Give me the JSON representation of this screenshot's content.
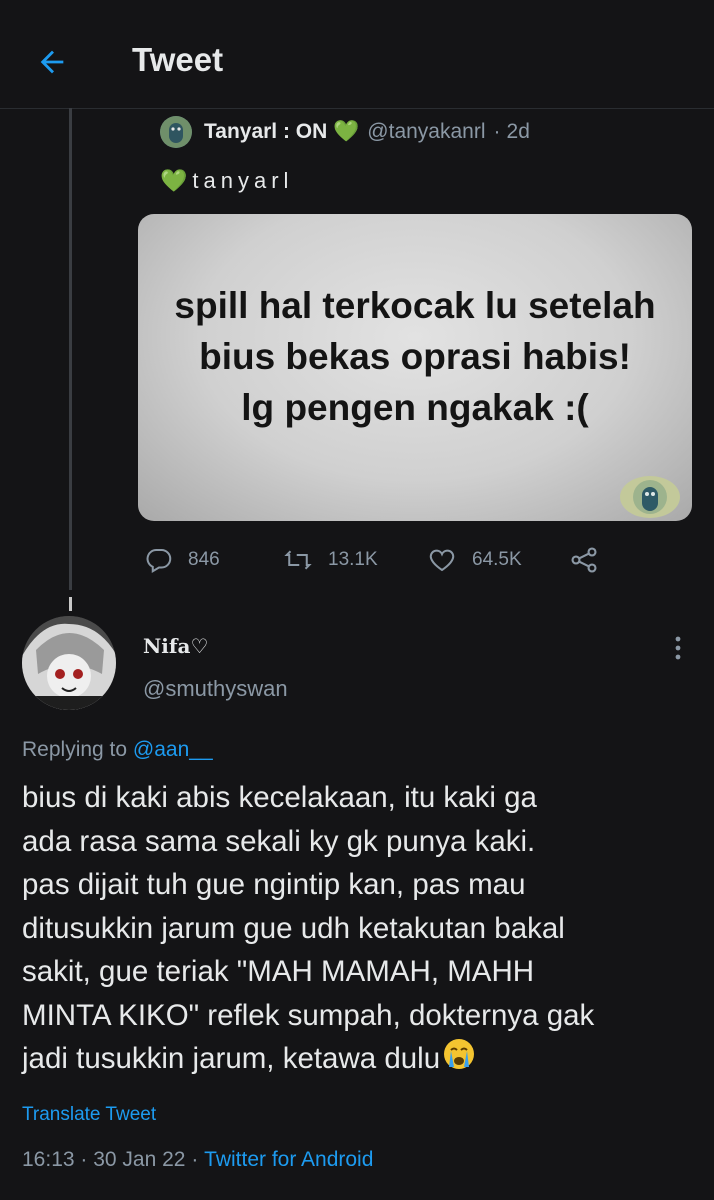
{
  "header": {
    "title": "Tweet"
  },
  "quoted_tweet": {
    "display_name": "Tanyarl : ON 💚",
    "handle": "@tanyakanrl",
    "separator": "·",
    "time": "2d",
    "body": "💚tanyarl",
    "image_text": "spill hal terkocak lu setelah\nbius bekas oprasi habis!\nlg pengen ngakak :("
  },
  "actions": {
    "replies": "846",
    "retweets": "13.1K",
    "likes": "64.5K"
  },
  "reply": {
    "display_name": "Nifa♡",
    "handle": "@smuthyswan",
    "replying_prefix": "Replying to ",
    "replying_to": "@aan__",
    "text": "bius di kaki abis kecelakaan, itu kaki ga\nada rasa sama sekali ky gk punya kaki.\npas dijait tuh gue ngintip kan, pas mau\nditusukkin jarum gue udh ketakutan bakal\nsakit, gue teriak \"MAH MAMAH, MAHH\nMINTA KIKO\" reflek sumpah, dokternya gak\njadi tusukkin jarum, ketawa dulu",
    "translate_label": "Translate Tweet",
    "time": "16:13",
    "sep1": " · ",
    "date": "30 Jan 22",
    "sep2": " · ",
    "source": "Twitter for Android"
  },
  "colors": {
    "background": "#141416",
    "accent": "#1d9bf0",
    "secondary_text": "#8b98a5",
    "heart_green": "#2ec95e"
  },
  "icons": [
    "back-arrow-icon",
    "reply-icon",
    "retweet-icon",
    "like-icon",
    "share-icon",
    "more-vertical-icon",
    "loudly-crying-emoji"
  ]
}
